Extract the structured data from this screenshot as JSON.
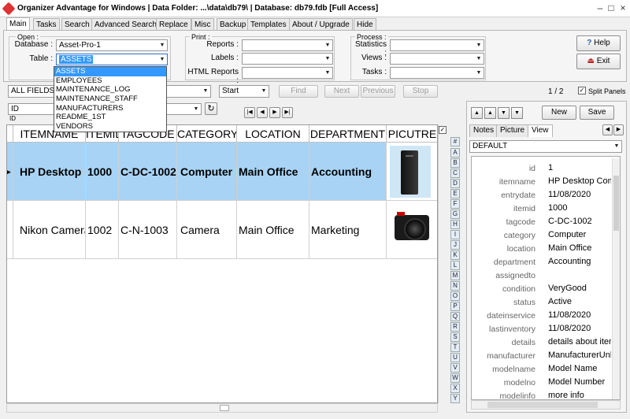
{
  "window": {
    "title": "Organizer Advantage for Windows | Data Folder: ...\\data\\db79\\ | Database: db79.fdb [Full Access]"
  },
  "tabs": [
    "Main",
    "Tasks",
    "Search",
    "Advanced Search",
    "Replace",
    "Misc",
    "Backup",
    "Templates",
    "About / Upgrade",
    "Hide"
  ],
  "open": {
    "label": "Open :",
    "database_label": "Database :",
    "database_value": "Asset-Pro-1",
    "table_label": "Table :",
    "table_value": "ASSETS"
  },
  "print": {
    "label": "Print :",
    "reports": "Reports :",
    "labels": "Labels :",
    "html_reports": "HTML Reports :"
  },
  "process": {
    "label": "Process :",
    "statistics": "Statistics :",
    "views": "Views :",
    "tasks": "Tasks :"
  },
  "buttons": {
    "help": "Help",
    "exit": "Exit",
    "find": "Find",
    "next": "Next",
    "previous": "Previous",
    "stop": "Stop",
    "new": "New",
    "save": "Save"
  },
  "dropdown_items": [
    "ASSETS",
    "EMPLOYEES",
    "MAINTENANCE_LOG",
    "MAINTENANCE_STAFF",
    "MANUFACTURERS",
    "README_1ST",
    "VENDORS"
  ],
  "search": {
    "field": "ALL FIELDS",
    "start": "Start",
    "page": "1 / 2",
    "split_panels": "Split Panels"
  },
  "sort": {
    "id_label": "ID",
    "id_sub": "ID"
  },
  "columns": [
    "ITEMNAME",
    "ITEMID",
    "TAGCODE",
    "CATEGORY",
    "LOCATION",
    "DEPARTMENT",
    "PICUTRE"
  ],
  "rows": [
    [
      "HP Desktop Computer",
      "1000",
      "C-DC-1002",
      "Computer",
      "Main Office",
      "Accounting"
    ],
    [
      "Nikon Camera",
      "1002",
      "C-N-1003",
      "Camera",
      "Main Office",
      "Marketing"
    ]
  ],
  "alpha": [
    "#",
    "A",
    "B",
    "C",
    "D",
    "E",
    "F",
    "G",
    "H",
    "I",
    "J",
    "K",
    "L",
    "M",
    "N",
    "O",
    "P",
    "Q",
    "R",
    "S",
    "T",
    "U",
    "V",
    "W",
    "X",
    "Y"
  ],
  "right_tabs": [
    "Notes",
    "Picture",
    "View"
  ],
  "view": {
    "selected": "DEFAULT"
  },
  "fields": [
    [
      "id",
      "1"
    ],
    [
      "itemname",
      "HP Desktop Computer"
    ],
    [
      "entrydate",
      "11/08/2020"
    ],
    [
      "itemid",
      "1000"
    ],
    [
      "tagcode",
      "C-DC-1002"
    ],
    [
      "category",
      "Computer"
    ],
    [
      "location",
      "Main Office"
    ],
    [
      "department",
      "Accounting"
    ],
    [
      "assignedto",
      ""
    ],
    [
      "condition",
      "VeryGood"
    ],
    [
      "status",
      "Active"
    ],
    [
      "dateinservice",
      "11/08/2020"
    ],
    [
      "lastinventory",
      "11/08/2020"
    ],
    [
      "details",
      "details about item"
    ],
    [
      "manufacturer",
      "ManufacturerUnknown"
    ],
    [
      "modelname",
      "Model Name"
    ],
    [
      "modelno",
      "Model Number"
    ],
    [
      "modelinfo",
      "more info"
    ]
  ]
}
